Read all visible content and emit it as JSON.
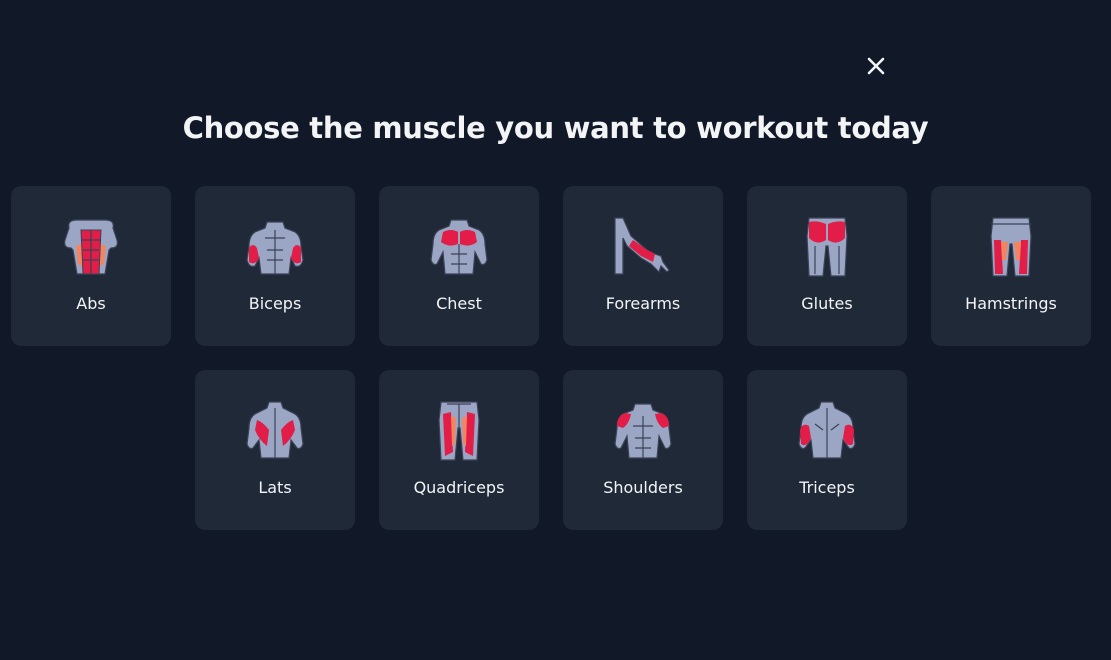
{
  "modal": {
    "title": "Choose the muscle you want to workout today",
    "close_icon": "close-icon"
  },
  "colors": {
    "background": "#111827",
    "card": "#1f2937",
    "text": "#f3f4f6",
    "body": "#9aa6c4",
    "highlight": "#e11d48",
    "accent": "#f4845f"
  },
  "muscles": [
    {
      "label": "Abs",
      "icon": "abs-icon"
    },
    {
      "label": "Biceps",
      "icon": "biceps-icon"
    },
    {
      "label": "Chest",
      "icon": "chest-icon"
    },
    {
      "label": "Forearms",
      "icon": "forearms-icon"
    },
    {
      "label": "Glutes",
      "icon": "glutes-icon"
    },
    {
      "label": "Hamstrings",
      "icon": "hamstrings-icon"
    },
    {
      "label": "Lats",
      "icon": "lats-icon"
    },
    {
      "label": "Quadriceps",
      "icon": "quadriceps-icon"
    },
    {
      "label": "Shoulders",
      "icon": "shoulders-icon"
    },
    {
      "label": "Triceps",
      "icon": "triceps-icon"
    }
  ]
}
